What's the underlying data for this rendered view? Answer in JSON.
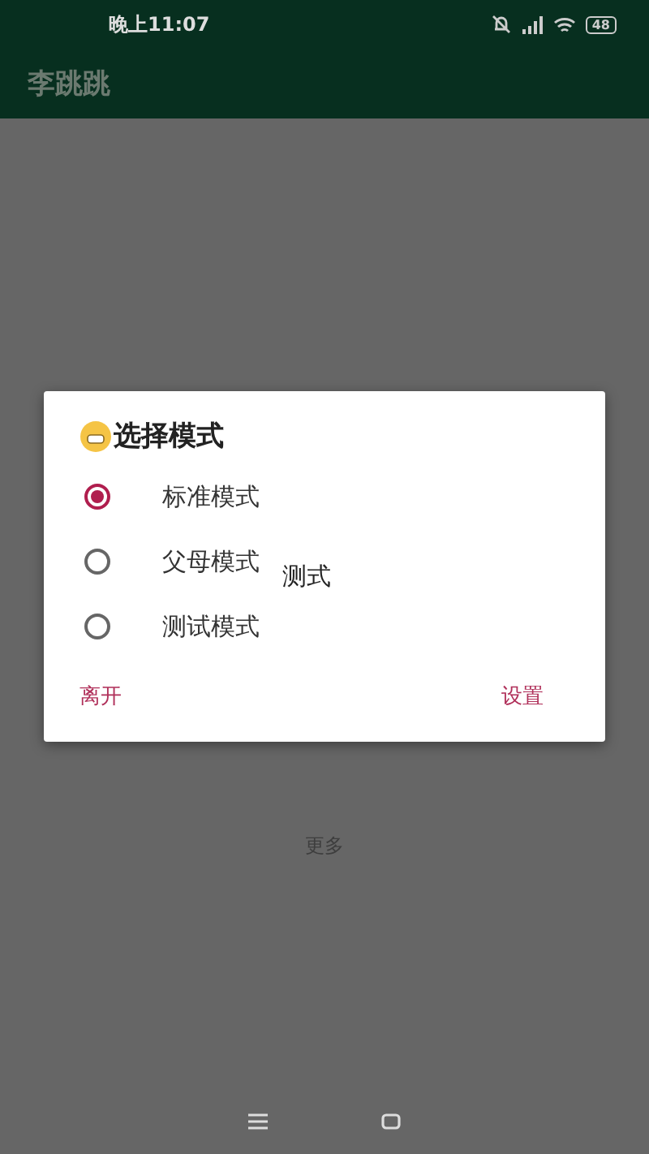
{
  "status_bar": {
    "time": "晚上11:07",
    "battery": "48"
  },
  "app_bar": {
    "title": "李跳跳"
  },
  "background": {
    "more_link": "更多"
  },
  "dialog": {
    "title": "选择模式",
    "options": [
      {
        "label": "标准模式",
        "selected": true
      },
      {
        "label": "父母模式",
        "selected": false
      },
      {
        "label": "测试模式",
        "selected": false
      }
    ],
    "stray_label": "测式",
    "buttons": [
      {
        "label": "离开"
      },
      {
        "label": "设置"
      }
    ]
  }
}
